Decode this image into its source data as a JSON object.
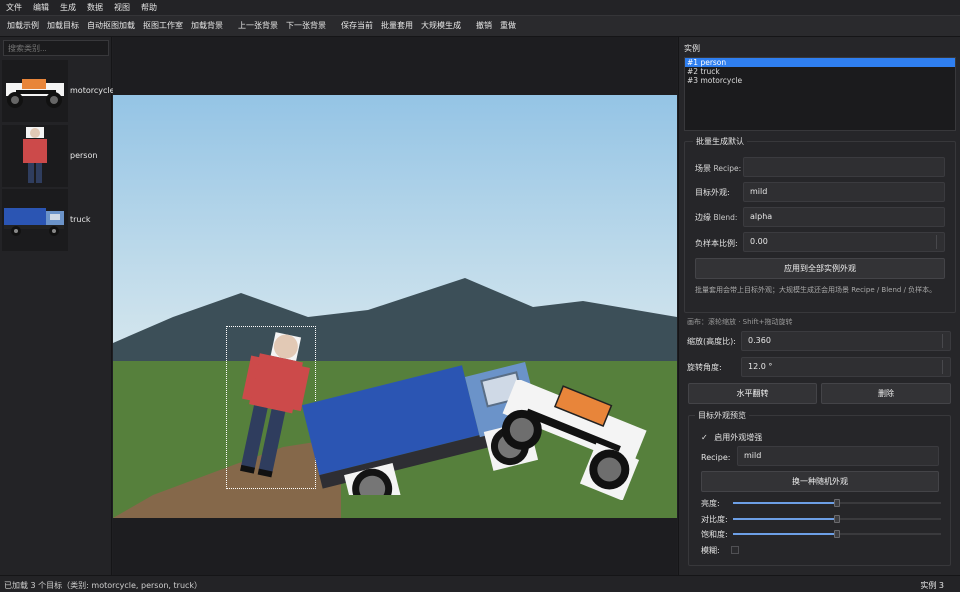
{
  "menu": [
    "文件",
    "编辑",
    "生成",
    "数据",
    "视图",
    "帮助"
  ],
  "toolbar": {
    "group1": [
      "加载示例",
      "加载目标",
      "自动抠图加载",
      "抠图工作室",
      "加载背景"
    ],
    "group2": [
      "上一张背景",
      "下一张背景"
    ],
    "group3": [
      "保存当前",
      "批量套用",
      "大规模生成"
    ],
    "group4": [
      "撤销",
      "重做"
    ]
  },
  "sidebar": {
    "search_placeholder": "搜索类别...",
    "categories": [
      {
        "label": "motorcycle",
        "icon": "motorcycle-thumbnail"
      },
      {
        "label": "person",
        "icon": "person-thumbnail"
      },
      {
        "label": "truck",
        "icon": "truck-thumbnail"
      }
    ]
  },
  "instances": {
    "title": "实例",
    "items": [
      "#1  person",
      "#2  truck",
      "#3  motorcycle"
    ],
    "selected_index": 0
  },
  "batch": {
    "title": "批量生成默认",
    "scene_label": "场景",
    "scene_label_en": "Recipe:",
    "scene_value": "",
    "appearance_label": "目标外观:",
    "appearance_value": "mild",
    "edge_label": "边缘",
    "edge_label_en": "Blend:",
    "edge_value": "alpha",
    "neg_label": "负样本比例:",
    "neg_value": "0.00",
    "apply_button": "应用到全部实例外观",
    "note": "批量套用会带上目标外观；大规模生成还会用场景 Recipe / Blend / 负样本。"
  },
  "canvas_hint": "画布：滚轮缩放 · Shift+拖动旋转",
  "transform": {
    "scale_label": "缩放(高度比):",
    "scale_value": "0.360",
    "rotate_label": "旋转角度:",
    "rotate_value": "12.0 °",
    "flip_button": "水平翻转",
    "delete_button": "删除"
  },
  "preview": {
    "title": "目标外观预览",
    "enable_check": "✓",
    "enable_label": "启用外观增强",
    "recipe_label": "Recipe:",
    "recipe_value": "mild",
    "random_button": "换一种随机外观",
    "sliders": [
      {
        "label": "亮度:",
        "value": 0.5
      },
      {
        "label": "对比度:",
        "value": 0.5
      },
      {
        "label": "饱和度:",
        "value": 0.5
      }
    ],
    "blur_label": "模糊:",
    "blur_value": 0
  },
  "status": {
    "left": "已加载 3 个目标（类别: motorcycle, person, truck）",
    "right": "实例 3"
  },
  "colors": {
    "accent": "#2f7ff0",
    "sky": "#9ec9e6",
    "mountain": "#3c4f58",
    "grass": "#56803c",
    "path": "#85684a",
    "person_shirt": "#cc4a4a",
    "truck_body": "#2b55b3",
    "truck_cab": "#6b93c9",
    "moto_tank": "#e8853a"
  }
}
